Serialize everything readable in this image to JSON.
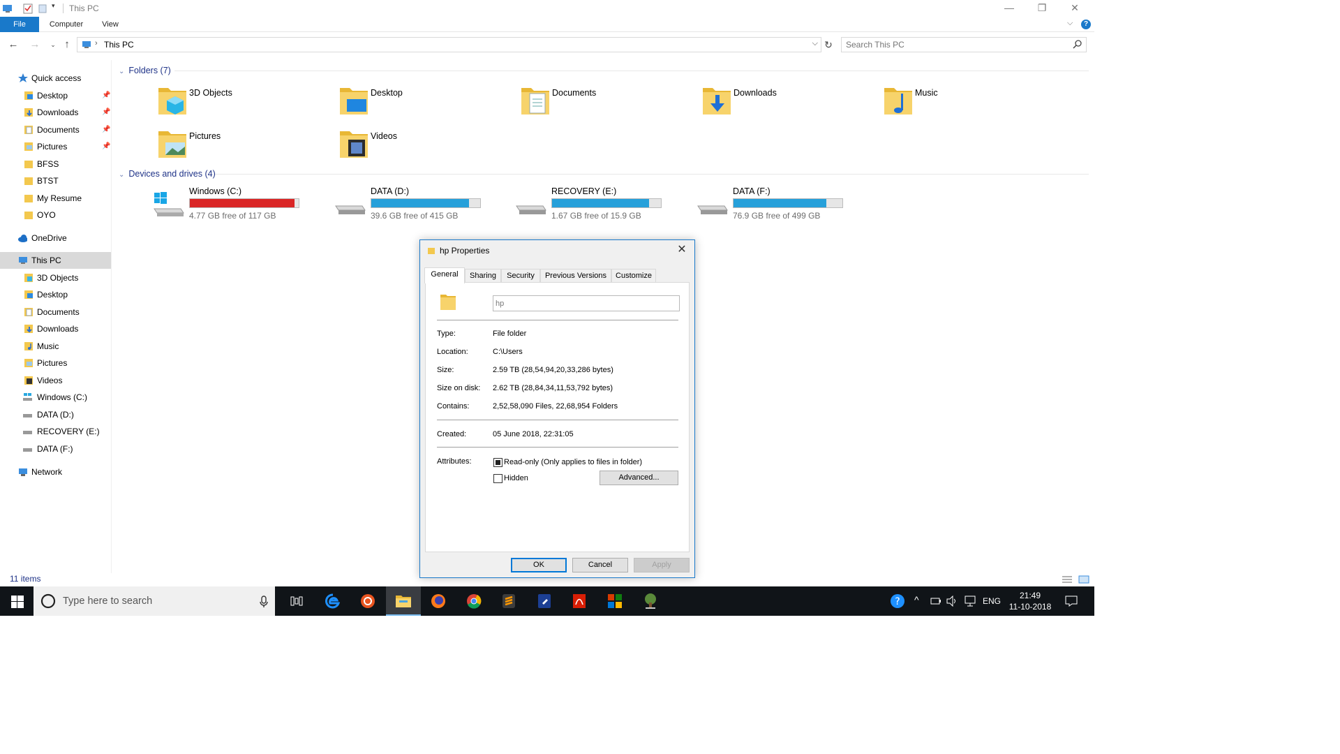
{
  "window": {
    "title": "This PC"
  },
  "ribbon": {
    "tabs": [
      "File",
      "Computer",
      "View"
    ]
  },
  "address": {
    "path": "This PC"
  },
  "search": {
    "placeholder": "Search This PC"
  },
  "sidebar": {
    "quick_access": "Quick access",
    "quick_items": [
      "Desktop",
      "Downloads",
      "Documents",
      "Pictures",
      "BFSS",
      "BTST",
      "My Resume",
      "OYO"
    ],
    "onedrive": "OneDrive",
    "this_pc": "This PC",
    "pc_items": [
      "3D Objects",
      "Desktop",
      "Documents",
      "Downloads",
      "Music",
      "Pictures",
      "Videos",
      "Windows (C:)",
      "DATA (D:)",
      "RECOVERY (E:)",
      "DATA  (F:)"
    ],
    "network": "Network"
  },
  "folders": {
    "header": "Folders (7)",
    "items": [
      "3D Objects",
      "Desktop",
      "Documents",
      "Downloads",
      "Music",
      "Pictures",
      "Videos"
    ]
  },
  "drives": {
    "header": "Devices and drives (4)",
    "items": [
      {
        "name": "Windows (C:)",
        "free": "4.77 GB free of 117 GB",
        "used_fraction": 0.96,
        "color": "#da2626"
      },
      {
        "name": "DATA (D:)",
        "free": "39.6 GB free of 415 GB",
        "used_fraction": 0.9,
        "color": "#26a0da"
      },
      {
        "name": "RECOVERY (E:)",
        "free": "1.67 GB free of 15.9 GB",
        "used_fraction": 0.89,
        "color": "#26a0da"
      },
      {
        "name": "DATA  (F:)",
        "free": "76.9 GB free of 499 GB",
        "used_fraction": 0.85,
        "color": "#26a0da"
      }
    ]
  },
  "status": {
    "items": "11 items"
  },
  "dialog": {
    "title": "hp Properties",
    "tabs": [
      "General",
      "Sharing",
      "Security",
      "Previous Versions",
      "Customize"
    ],
    "name_value": "hp",
    "type_label": "Type:",
    "type_value": "File folder",
    "location_label": "Location:",
    "location_value": "C:\\Users",
    "size_label": "Size:",
    "size_value": "2.59 TB (28,54,94,20,33,286 bytes)",
    "sizeondisk_label": "Size on disk:",
    "sizeondisk_value": "2.62 TB (28,84,34,11,53,792 bytes)",
    "contains_label": "Contains:",
    "contains_value": "2,52,58,090 Files, 22,68,954 Folders",
    "created_label": "Created:",
    "created_value": "05 June 2018, 22:31:05",
    "attributes_label": "Attributes:",
    "readonly_label": "Read-only (Only applies to files in folder)",
    "hidden_label": "Hidden",
    "advanced_label": "Advanced...",
    "ok_label": "OK",
    "cancel_label": "Cancel",
    "apply_label": "Apply"
  },
  "taskbar": {
    "search_placeholder": "Type here to search",
    "language": "ENG",
    "time": "21:49",
    "date": "11-10-2018"
  }
}
